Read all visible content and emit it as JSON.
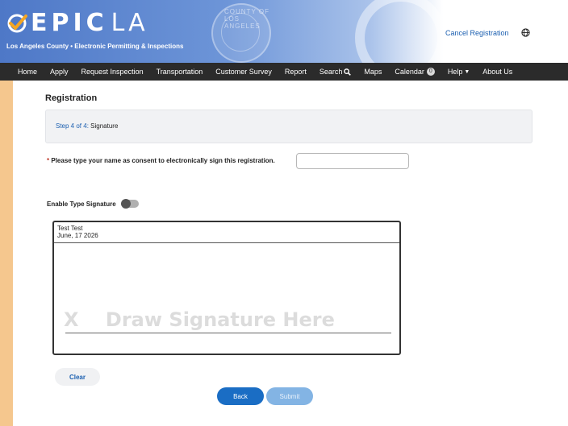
{
  "header": {
    "logo_text": "EPIC",
    "logo_suffix": "LA",
    "tagline": "Los Angeles County • Electronic Permitting & Inspections",
    "seal_text": "COUNTY OF LOS ANGELES",
    "cancel_label": "Cancel Registration",
    "globe_icon": "globe-icon"
  },
  "nav": {
    "items": [
      "Home",
      "Apply",
      "Request Inspection",
      "Transportation",
      "Customer Survey",
      "Report",
      "Search",
      "Maps",
      "Calendar",
      "Help",
      "About Us"
    ],
    "calendar_count": "0"
  },
  "page": {
    "title": "Registration",
    "step_label": "Step 4 of 4:",
    "step_name": "Signature"
  },
  "consent": {
    "required_mark": "*",
    "label": "Please type your name as consent to electronically sign this registration.",
    "input_value": ""
  },
  "type_signature": {
    "label": "Enable Type Signature",
    "enabled": false
  },
  "signature_pad": {
    "name_line": "Test Test",
    "date_line": "June, 17 2026",
    "placeholder": "X    Draw Signature Here"
  },
  "buttons": {
    "clear": "Clear",
    "back": "Back",
    "submit": "Submit"
  },
  "colors": {
    "accent": "#1a6dc4",
    "nav_bg": "#2b2b2b",
    "page_bg": "#f5c78e"
  }
}
